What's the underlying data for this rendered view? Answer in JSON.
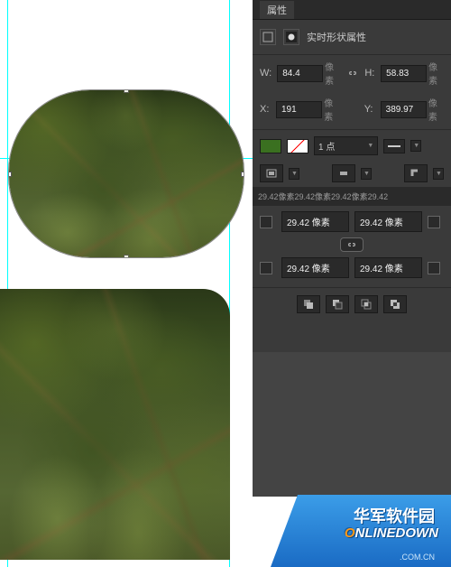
{
  "panel": {
    "tab": "属性",
    "title": "实时形状属性",
    "W_label": "W:",
    "H_label": "H:",
    "X_label": "X:",
    "Y_label": "Y:",
    "W_value": "84.4",
    "H_value": "58.83",
    "X_value": "191",
    "Y_value": "389.97",
    "px_unit": "像素",
    "stroke_width": "1 点",
    "corner_bar": "29.42像素29.42像素29.42像素29.42",
    "corner_tl": "29.42 像素",
    "corner_tr": "29.42 像素",
    "corner_bl": "29.42 像素",
    "corner_br": "29.42 像素"
  },
  "watermark": {
    "cn": "华军软件园",
    "en_pre": "O",
    "en_rest": "NLINEDOWN",
    "sub": ".COM.CN"
  }
}
